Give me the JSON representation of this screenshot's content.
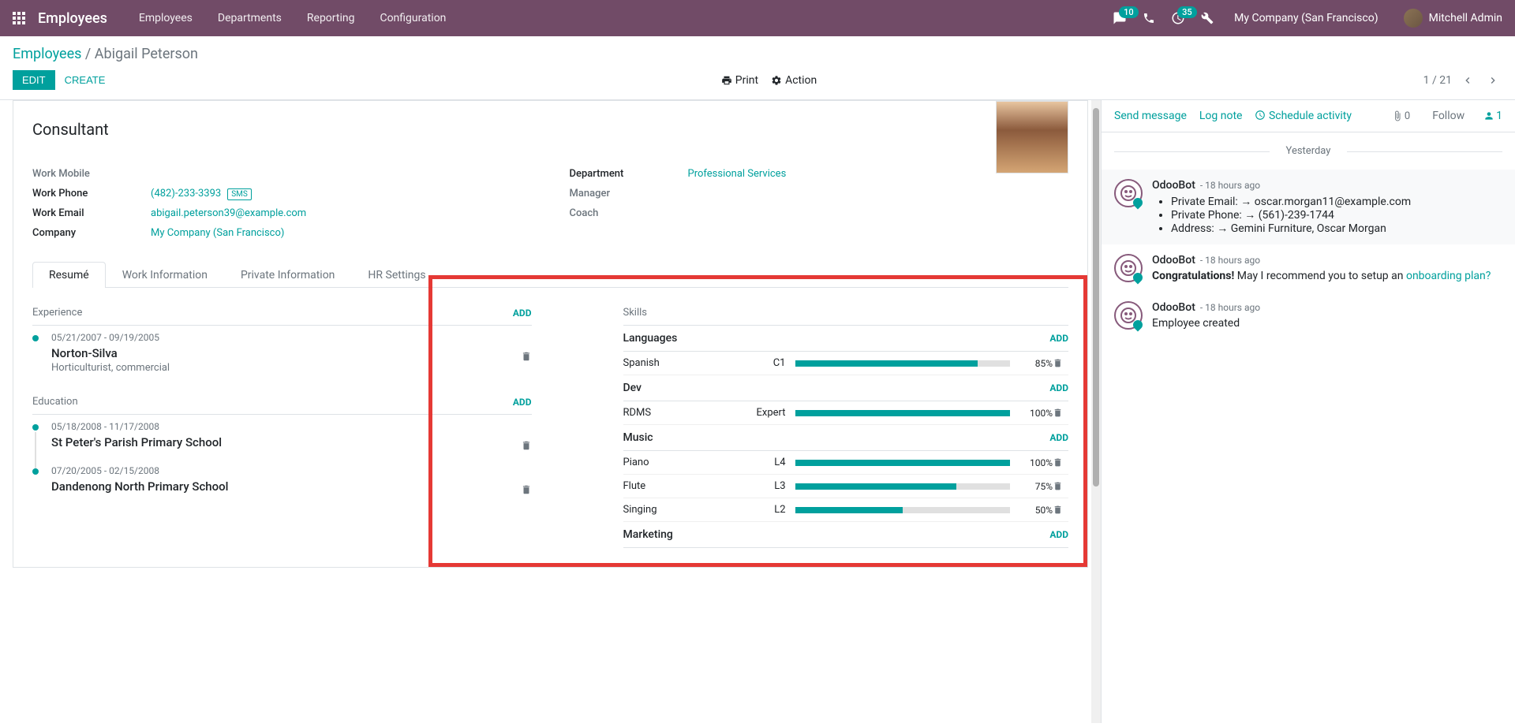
{
  "nav": {
    "brand": "Employees",
    "items": [
      "Employees",
      "Departments",
      "Reporting",
      "Configuration"
    ],
    "messages_badge": "10",
    "activities_badge": "35",
    "company": "My Company (San Francisco)",
    "user": "Mitchell Admin"
  },
  "breadcrumb": {
    "root": "Employees",
    "current": "Abigail Peterson"
  },
  "buttons": {
    "edit": "EDIT",
    "create": "CREATE",
    "print": "Print",
    "action": "Action"
  },
  "pager": {
    "text": "1 / 21"
  },
  "employee": {
    "title": "Consultant",
    "fields_left": [
      {
        "label": "Work Mobile",
        "value": "",
        "muted": true
      },
      {
        "label": "Work Phone",
        "value": "(482)-233-3393",
        "link": true,
        "sms": "SMS"
      },
      {
        "label": "Work Email",
        "value": "abigail.peterson39@example.com",
        "link": true
      },
      {
        "label": "Company",
        "value": "My Company (San Francisco)",
        "link": true
      }
    ],
    "fields_right": [
      {
        "label": "Department",
        "value": "Professional Services",
        "link": true
      },
      {
        "label": "Manager",
        "value": "",
        "muted": true
      },
      {
        "label": "Coach",
        "value": "",
        "muted": true
      }
    ]
  },
  "tabs": [
    "Resumé",
    "Work Information",
    "Private Information",
    "HR Settings"
  ],
  "resume": {
    "experience": {
      "label": "Experience",
      "add": "ADD",
      "items": [
        {
          "dates": "05/21/2007 - 09/19/2005",
          "title": "Norton-Silva",
          "sub": "Horticulturist, commercial"
        }
      ]
    },
    "education": {
      "label": "Education",
      "add": "ADD",
      "items": [
        {
          "dates": "05/18/2008 - 11/17/2008",
          "title": "St Peter's Parish Primary School"
        },
        {
          "dates": "07/20/2005 - 02/15/2008",
          "title": "Dandenong North Primary School"
        }
      ]
    }
  },
  "skills": {
    "header": "Skills",
    "add": "ADD",
    "groups": [
      {
        "name": "Languages",
        "items": [
          {
            "skill": "Spanish",
            "level": "C1",
            "pct": 85
          }
        ]
      },
      {
        "name": "Dev",
        "items": [
          {
            "skill": "RDMS",
            "level": "Expert",
            "pct": 100
          }
        ]
      },
      {
        "name": "Music",
        "items": [
          {
            "skill": "Piano",
            "level": "L4",
            "pct": 100
          },
          {
            "skill": "Flute",
            "level": "L3",
            "pct": 75
          },
          {
            "skill": "Singing",
            "level": "L2",
            "pct": 50
          }
        ]
      },
      {
        "name": "Marketing",
        "items": []
      }
    ]
  },
  "chatter": {
    "send": "Send message",
    "log": "Log note",
    "schedule": "Schedule activity",
    "attach_count": "0",
    "follow": "Follow",
    "followers": "1",
    "date_sep": "Yesterday",
    "messages": [
      {
        "author": "OdooBot",
        "time": "- 18 hours ago",
        "shaded": true,
        "list": [
          "Private Email: → oscar.morgan11@example.com",
          "Private Phone: → (561)-239-1744",
          "Address: → Gemini Furniture, Oscar Morgan"
        ]
      },
      {
        "author": "OdooBot",
        "time": "- 18 hours ago",
        "html": "Congratulations! May I recommend you to setup an <a>onboarding plan?</a>"
      },
      {
        "author": "OdooBot",
        "time": "- 18 hours ago",
        "text": "Employee created"
      }
    ]
  }
}
